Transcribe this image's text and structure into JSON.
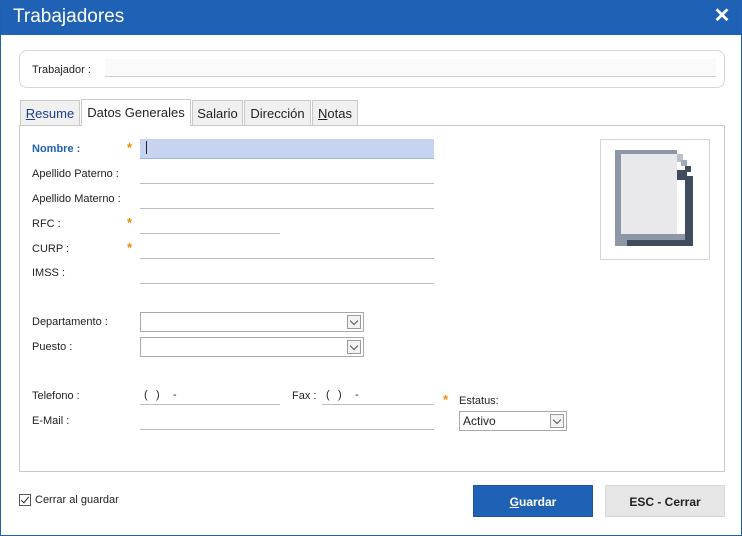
{
  "window": {
    "title": "Trabajadores"
  },
  "worker": {
    "label": "Trabajador :",
    "value": ""
  },
  "tabs": [
    {
      "label": "Resume",
      "underline": "R",
      "rest": "esume"
    },
    {
      "label": "Datos Generales"
    },
    {
      "label": "Salario"
    },
    {
      "label": "Dirección"
    },
    {
      "label": "Notas",
      "underline": "N",
      "rest": "otas"
    }
  ],
  "form": {
    "nombre": {
      "label": "Nombre :",
      "value": ""
    },
    "apellido_paterno": {
      "label": "Apellido Paterno :",
      "value": ""
    },
    "apellido_materno": {
      "label": "Apellido Materno :",
      "value": ""
    },
    "rfc": {
      "label": "RFC :",
      "value": ""
    },
    "curp": {
      "label": "CURP :",
      "value": ""
    },
    "imss": {
      "label": "IMSS :",
      "value": ""
    },
    "departamento": {
      "label": "Departamento :",
      "value": ""
    },
    "puesto": {
      "label": "Puesto :",
      "value": ""
    },
    "telefono": {
      "label": "Telefono :",
      "paren_open": "(",
      "paren_close": ")",
      "dash": "-"
    },
    "fax": {
      "label": "Fax :",
      "paren_open": "(",
      "paren_close": ")",
      "dash": "-"
    },
    "email": {
      "label": "E-Mail :",
      "value": ""
    },
    "estatus": {
      "label": "Estatus:",
      "value": "Activo"
    },
    "required_mark": "*"
  },
  "footer": {
    "close_on_save_label": "Cerrar al guardar",
    "close_on_save_checked": true,
    "save_first_letter": "G",
    "save_rest": "uardar",
    "close_label": "ESC - Cerrar"
  },
  "colors": {
    "accent": "#1f62b5",
    "required": "#f08a00",
    "focus": "#c6d4f2"
  },
  "icons": {
    "close": "close-icon",
    "photo": "document-placeholder-icon",
    "dropdown": "chevron-down-icon",
    "checkbox": "checkmark-icon"
  }
}
